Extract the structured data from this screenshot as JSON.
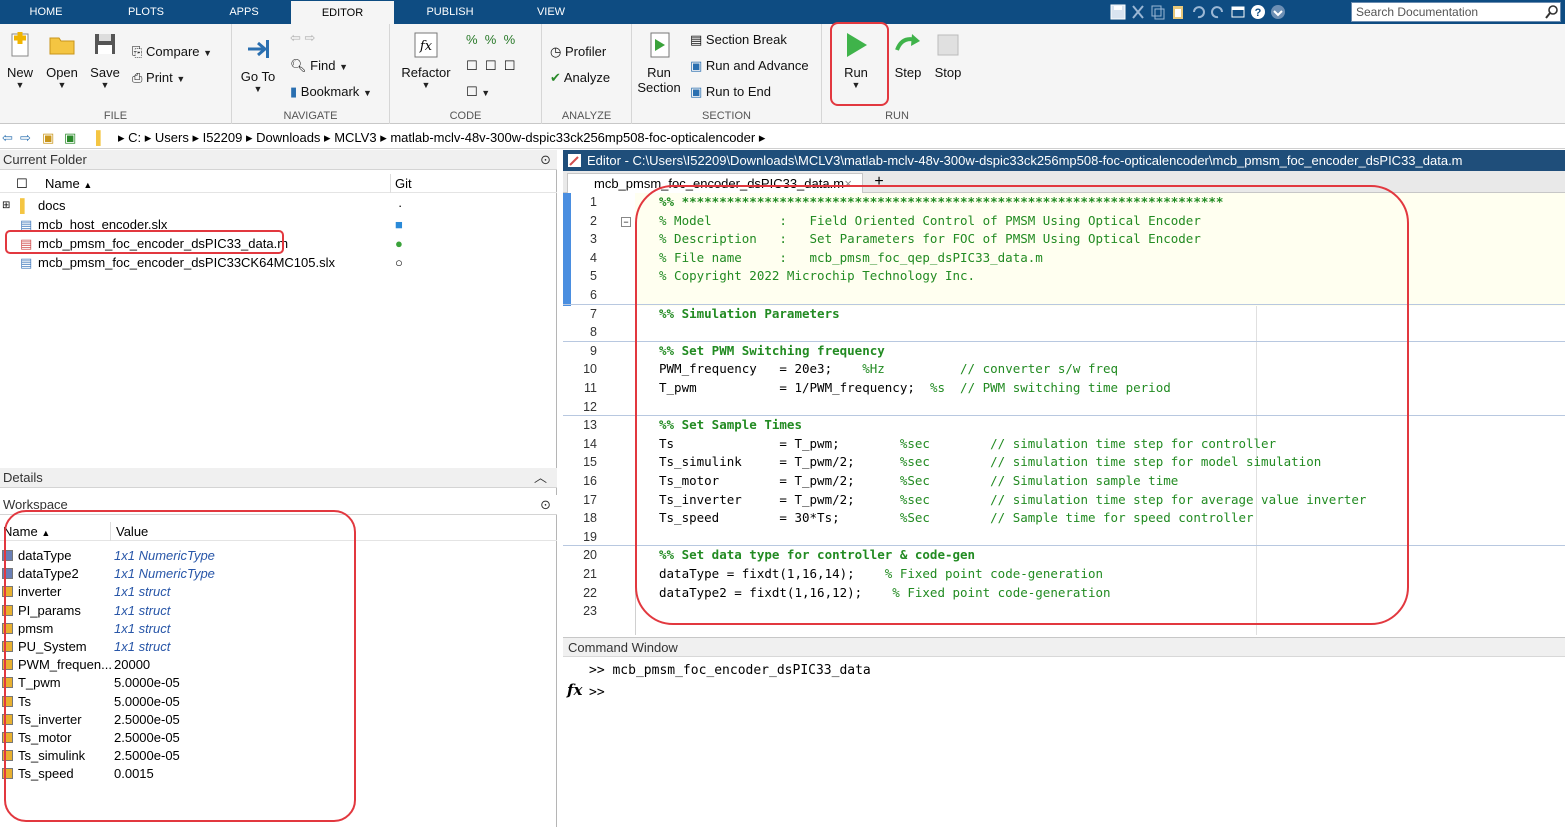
{
  "tabs": [
    "HOME",
    "PLOTS",
    "APPS",
    "EDITOR",
    "PUBLISH",
    "VIEW"
  ],
  "search_placeholder": "Search Documentation",
  "ribbon": {
    "file": {
      "label": "FILE",
      "new": "New",
      "open": "Open",
      "save": "Save",
      "compare": "Compare",
      "print": "Print"
    },
    "navigate": {
      "label": "NAVIGATE",
      "goto": "Go To",
      "find": "Find",
      "bookmark": "Bookmark"
    },
    "code": {
      "label": "CODE",
      "refactor": "Refactor"
    },
    "analyze": {
      "label": "ANALYZE",
      "profiler": "Profiler",
      "analyze": "Analyze"
    },
    "section": {
      "label": "SECTION",
      "run_section_1": "Run",
      "run_section_2": "Section",
      "section_break": "Section Break",
      "run_advance": "Run and Advance",
      "run_end": "Run to End"
    },
    "run": {
      "label": "RUN",
      "run": "Run",
      "step": "Step",
      "stop": "Stop"
    }
  },
  "address": [
    "C:",
    "Users",
    "I52209",
    "Downloads",
    "MCLV3",
    "matlab-mclv-48v-300w-dspic33ck256mp508-foc-opticalencoder"
  ],
  "current_folder": {
    "title": "Current Folder",
    "col_name": "Name",
    "col_git": "Git",
    "files": [
      {
        "name": "docs",
        "git": "·"
      },
      {
        "name": "mcb_host_encoder.slx",
        "git": "■"
      },
      {
        "name": "mcb_pmsm_foc_encoder_dsPIC33_data.m",
        "git": "●"
      },
      {
        "name": "mcb_pmsm_foc_encoder_dsPIC33CK64MC105.slx",
        "git": "○"
      }
    ]
  },
  "details_title": "Details",
  "workspace": {
    "title": "Workspace",
    "col_name": "Name",
    "col_value": "Value",
    "vars": [
      {
        "name": "dataType",
        "value": "1x1 NumericType"
      },
      {
        "name": "dataType2",
        "value": "1x1 NumericType"
      },
      {
        "name": "inverter",
        "value": "1x1 struct"
      },
      {
        "name": "PI_params",
        "value": "1x1 struct"
      },
      {
        "name": "pmsm",
        "value": "1x1 struct"
      },
      {
        "name": "PU_System",
        "value": "1x1 struct"
      },
      {
        "name": "PWM_frequen...",
        "value": "20000"
      },
      {
        "name": "T_pwm",
        "value": "5.0000e-05"
      },
      {
        "name": "Ts",
        "value": "5.0000e-05"
      },
      {
        "name": "Ts_inverter",
        "value": "2.5000e-05"
      },
      {
        "name": "Ts_motor",
        "value": "2.5000e-05"
      },
      {
        "name": "Ts_simulink",
        "value": "2.5000e-05"
      },
      {
        "name": "Ts_speed",
        "value": "0.0015"
      }
    ]
  },
  "editor": {
    "title": "Editor - C:\\Users\\I52209\\Downloads\\MCLV3\\matlab-mclv-48v-300w-dspic33ck256mp508-foc-opticalencoder\\mcb_pmsm_foc_encoder_dsPIC33_data.m",
    "tab": "mcb_pmsm_foc_encoder_dsPIC33_data.m",
    "lines": [
      "%% ************************************************************************",
      "% Model         :   Field Oriented Control of PMSM Using Optical Encoder",
      "% Description   :   Set Parameters for FOC of PMSM Using Optical Encoder",
      "% File name     :   mcb_pmsm_foc_qep_dsPIC33_data.m",
      "% Copyright 2022 Microchip Technology Inc.",
      "",
      "%% Simulation Parameters",
      "",
      "%% Set PWM Switching frequency",
      "PWM_frequency   = 20e3;    %Hz          // converter s/w freq",
      "T_pwm           = 1/PWM_frequency;  %s  // PWM switching time period",
      "",
      "%% Set Sample Times",
      "Ts              = T_pwm;        %sec        // simulation time step for controller",
      "Ts_simulink     = T_pwm/2;      %sec        // simulation time step for model simulation",
      "Ts_motor        = T_pwm/2;      %Sec        // Simulation sample time",
      "Ts_inverter     = T_pwm/2;      %sec        // simulation time step for average value inverter",
      "Ts_speed        = 30*Ts;        %Sec        // Sample time for speed controller",
      "",
      "%% Set data type for controller & code-gen",
      "dataType = fixdt(1,16,14);    % Fixed point code-generation",
      "dataType2 = fixdt(1,16,12);    % Fixed point code-generation",
      ""
    ]
  },
  "command_window": {
    "title": "Command Window",
    "history": ">> mcb_pmsm_foc_encoder_dsPIC33_data",
    "prompt": ">>",
    "fx": "fx"
  }
}
